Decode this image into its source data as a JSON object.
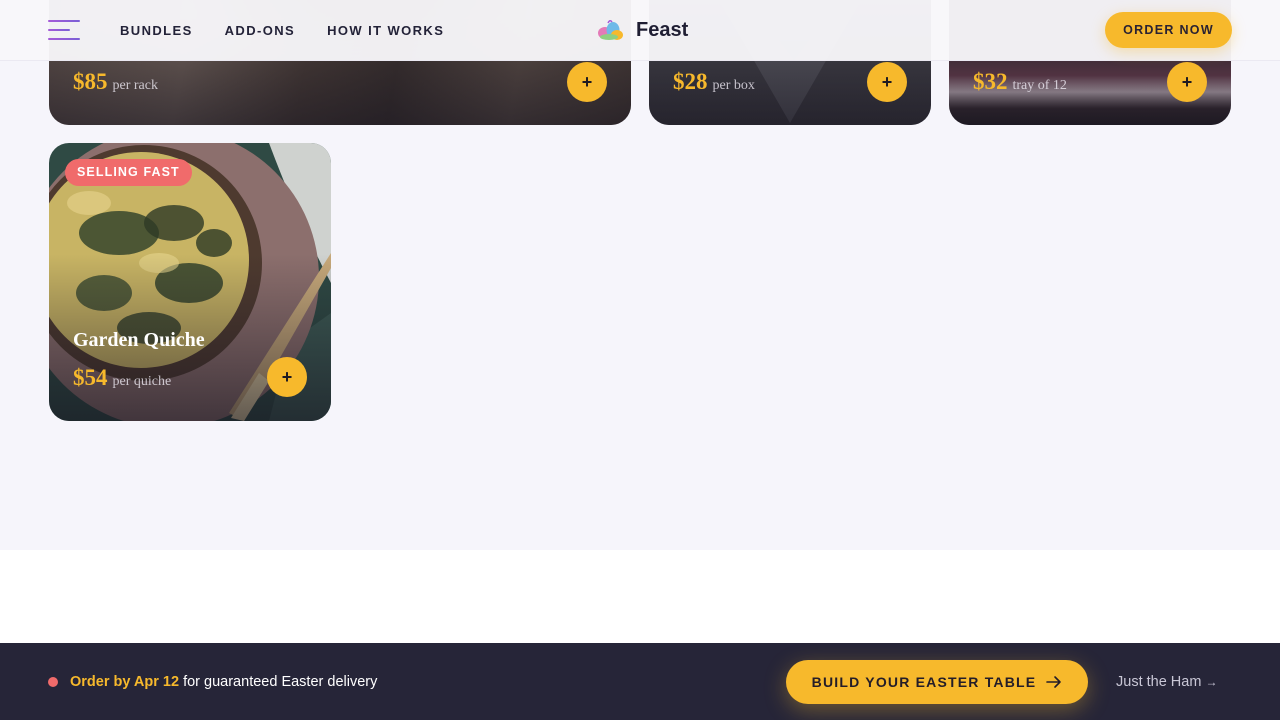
{
  "header": {
    "nav": [
      "BUNDLES",
      "ADD-ONS",
      "HOW IT WORKS"
    ],
    "brand": "Feast",
    "order_label": "ORDER NOW"
  },
  "cards": [
    {
      "price": "$85",
      "unit": "per rack",
      "add": "+"
    },
    {
      "price": "$28",
      "unit": "per box",
      "add": "+"
    },
    {
      "price": "$32",
      "unit": "tray of 12",
      "add": "+"
    },
    {
      "badge": "SELLING FAST",
      "title": "Garden Quiche",
      "price": "$54",
      "unit": "per quiche",
      "add": "+"
    }
  ],
  "bottom_bar": {
    "deadline_highlight": "Order by Apr 12",
    "deadline_rest": " for guaranteed Easter delivery",
    "cta_label": "BUILD YOUR EASTER TABLE",
    "secondary_label": "Just the Ham",
    "secondary_arrow": "→"
  },
  "colors": {
    "accent": "#f7b92c",
    "badge": "#f06b6b",
    "dark": "#262538",
    "page_bg": "#f6f5fb"
  },
  "icons": [
    "menu-icon",
    "logo-egg-icon",
    "plus-icon",
    "arrow-right-icon"
  ]
}
